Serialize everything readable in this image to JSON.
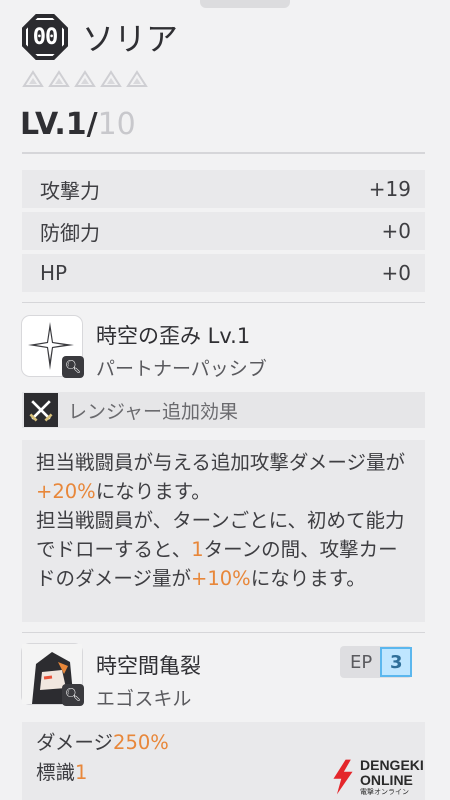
{
  "character": {
    "badge": "00",
    "name": "ソリア",
    "stars": 5,
    "level": "LV.1/",
    "level_max": "10"
  },
  "stats": [
    {
      "label": "攻撃力",
      "value": "+19"
    },
    {
      "label": "防御力",
      "value": "+0"
    },
    {
      "label": "HP",
      "value": "+0"
    }
  ],
  "passive": {
    "title": "時空の歪み Lv.1",
    "type": "パートナーパッシブ",
    "ranger_label": "レンジャー追加効果",
    "desc_1": "担当戦闘員が与える追加攻撃ダメージ量が",
    "desc_1_hl": "+20%",
    "desc_1_end": "になります。",
    "desc_2": "担当戦闘員が、ターンごとに、初めて能力でドローすると、",
    "desc_2_hl": "1",
    "desc_2_mid": "ターンの間、攻撃カードのダメージ量が",
    "desc_2_hl2": "+10%",
    "desc_2_end": "になります。"
  },
  "ego": {
    "title": "時空間亀裂",
    "type": "エゴスキル",
    "ep_label": "EP",
    "ep_value": "3",
    "damage_label": "ダメージ",
    "damage_value": "250%",
    "mark_label": "標識",
    "mark_value": "1"
  },
  "watermark": {
    "line1": "DENGEKI",
    "line2": "ONLINE",
    "line3": "電撃オンライン"
  },
  "colors": {
    "highlight": "#e8873a",
    "ep_fill": "#bfe6ff",
    "watermark_red": "#e4262b"
  }
}
